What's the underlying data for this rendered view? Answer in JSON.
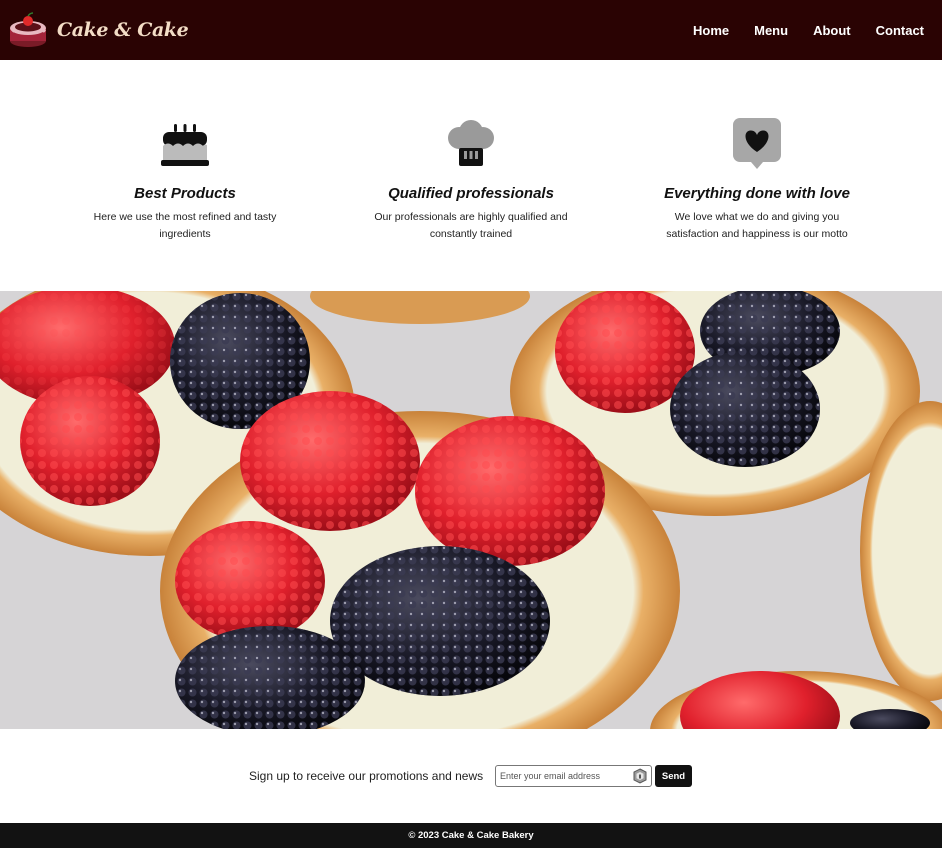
{
  "header": {
    "brand_name": "Cake & Cake",
    "logo_icon": "cake-logo-icon",
    "nav": [
      {
        "label": "Home"
      },
      {
        "label": "Menu"
      },
      {
        "label": "About"
      },
      {
        "label": "Contact"
      }
    ],
    "background_color": "#2a0303"
  },
  "features": [
    {
      "icon": "birthday-cake-icon",
      "title": "Best Products",
      "description": "Here we use the most refined and tasty ingredients"
    },
    {
      "icon": "chef-hat-icon",
      "title": "Qualified professionals",
      "description": "Our professionals are highly qualified and constantly trained"
    },
    {
      "icon": "heart-chat-icon",
      "title": "Everything done with love",
      "description": "We love what we do and giving you satisfaction and happiness is our motto"
    }
  ],
  "hero": {
    "image_description_icon": "berry-tarts-image"
  },
  "newsletter": {
    "text": "Sign up to receive our promotions and news",
    "input_placeholder": "Enter your email address",
    "button_label": "Send"
  },
  "footer": {
    "text": "© 2023 Cake & Cake Bakery"
  }
}
